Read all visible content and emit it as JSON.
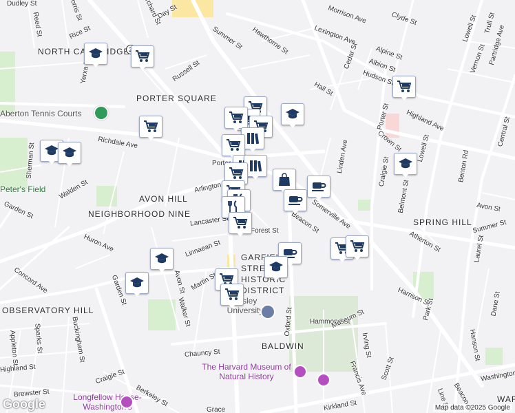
{
  "map": {
    "neighborhoods": [
      "NORTH CAMBRIDGE",
      "PORTER SQUARE",
      "AVON HILL",
      "NEIGHBORHOOD NINE",
      "OBSERVATORY HILL",
      "SPRING HILL",
      "GARFIELD STREET HISTORIC DISTRICT",
      "BALDWIN",
      "WAR"
    ],
    "streets": [
      "Dudley St",
      "Norris St",
      "Orchard St",
      "Day St",
      "Reed St",
      "Rice St",
      "Yerxa Rd",
      "Russell St",
      "Summer St",
      "Hawthorne St",
      "Morrison Ave",
      "Clyde St",
      "Lexington Ave",
      "Alpine St",
      "Albion St",
      "Hudson St",
      "Cedar St",
      "Trull St",
      "Lowell St",
      "Partridge Ave",
      "Vernon St",
      "Hall St",
      "Highland Ave",
      "Porter St",
      "Crown St",
      "Lowell St",
      "Linden Ave",
      "Richdale Ave",
      "Sherman St",
      "Walden St",
      "Garden St",
      "Arlington St",
      "Lancaster St",
      "Forest St",
      "Somerville Ave",
      "Beacon St",
      "Craigie St",
      "Belmont St",
      "Benton Rd",
      "Central St",
      "Avon St",
      "Summer St",
      "Atherton St",
      "Laurel St",
      "Huron Ave",
      "Linnaean St",
      "Avon St",
      "Walker St",
      "Martin St",
      "Concord Ave",
      "Garden St",
      "Buckingham St",
      "Sparks St",
      "Appleton St",
      "Highland St",
      "Chauncy St",
      "Hammond St",
      "Museum St",
      "Oxford St",
      "Harrison St",
      "Park St",
      "Dane St",
      "Hanson St",
      "Irving St",
      "Scott St",
      "Francis Ave",
      "Brewster St",
      "Craigie St",
      "Berkeley St",
      "Kirkland St",
      "Beacon St",
      "Washington St",
      "Line St",
      "Porter Sq"
    ],
    "pois": {
      "tennis": "Aberton Tennis Courts",
      "peters_field": "Peter's Field",
      "lesley": "Lesley University",
      "museum": "The Harvard Museum of Natural History",
      "longfellow": "Longfellow House-Washington's",
      "grace": "Grace"
    },
    "route": "2",
    "attribution": "Map data ©2025 Google",
    "logo": "Google"
  }
}
